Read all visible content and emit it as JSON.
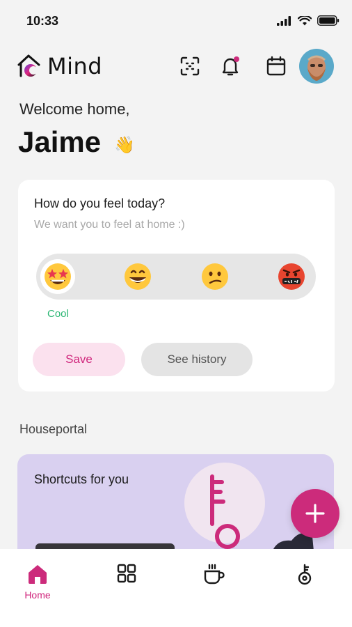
{
  "status_bar": {
    "time": "10:33"
  },
  "header": {
    "app_name": "Mind"
  },
  "greeting": {
    "welcome": "Welcome home,",
    "name": "Jaime"
  },
  "mood_card": {
    "question": "How do you feel today?",
    "subtitle": "We want you to feel at home :)",
    "options": [
      {
        "id": "cool",
        "icon": "star-struck-face",
        "selected": true
      },
      {
        "id": "happy",
        "icon": "grinning-face",
        "selected": false
      },
      {
        "id": "confused",
        "icon": "confused-face",
        "selected": false
      },
      {
        "id": "angry",
        "icon": "cursing-face",
        "selected": false
      }
    ],
    "selected_label": "Cool",
    "save_label": "Save",
    "history_label": "See history"
  },
  "houseportal": {
    "section_title": "Houseportal",
    "card_title": "Shortcuts for you"
  },
  "bottom_nav": {
    "items": [
      {
        "icon": "home-icon",
        "label": "Home",
        "active": true
      },
      {
        "icon": "grid-icon",
        "label": "",
        "active": false
      },
      {
        "icon": "coffee-icon",
        "label": "",
        "active": false
      },
      {
        "icon": "key-icon",
        "label": "",
        "active": false
      }
    ]
  },
  "colors": {
    "accent": "#cc2b7b",
    "mood_selected": "#2bb673",
    "shortcut_bg": "#d9d0f0"
  }
}
